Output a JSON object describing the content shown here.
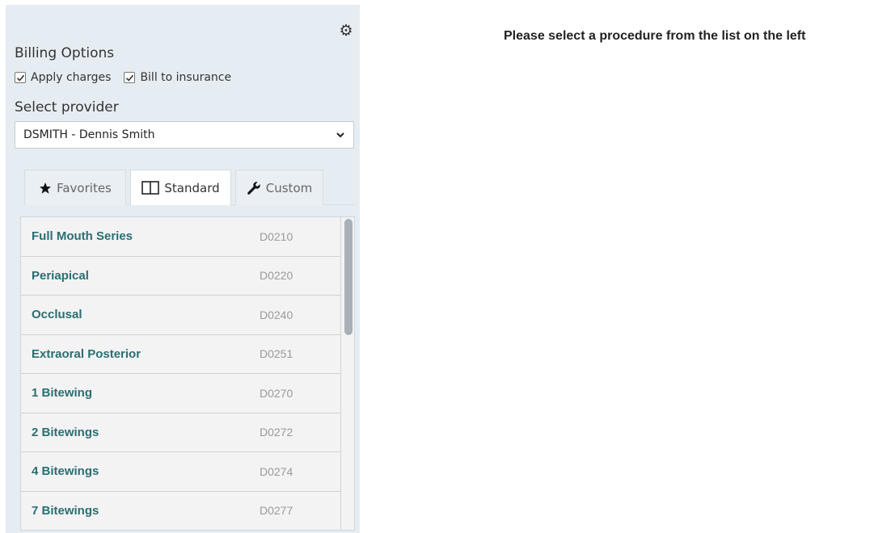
{
  "billing": {
    "title": "Billing Options",
    "apply_charges_label": "Apply charges",
    "bill_insurance_label": "Bill to insurance"
  },
  "provider": {
    "title": "Select provider",
    "selected": "DSMITH - Dennis Smith"
  },
  "tabs": [
    {
      "label": "Favorites",
      "icon": "star-icon"
    },
    {
      "label": "Standard",
      "icon": "book-icon"
    },
    {
      "label": "Custom",
      "icon": "wrench-icon"
    }
  ],
  "procedures": [
    {
      "name": "Full Mouth Series",
      "code": "D0210"
    },
    {
      "name": "Periapical",
      "code": "D0220"
    },
    {
      "name": "Occlusal",
      "code": "D0240"
    },
    {
      "name": "Extraoral Posterior",
      "code": "D0251"
    },
    {
      "name": "1 Bitewing",
      "code": "D0270"
    },
    {
      "name": "2 Bitewings",
      "code": "D0272"
    },
    {
      "name": "4 Bitewings",
      "code": "D0274"
    },
    {
      "name": "7 Bitewings",
      "code": "D0277"
    }
  ],
  "main": {
    "prompt": "Please select a procedure from the list on the left"
  },
  "colors": {
    "panel_bg": "#e6edf2",
    "procedure_name": "#2a6e72",
    "procedure_code": "#9a9a9a"
  }
}
